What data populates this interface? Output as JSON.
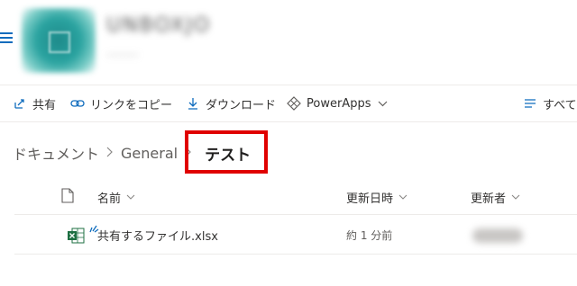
{
  "site": {
    "name": "UNBOXJO",
    "subtitle": "········"
  },
  "commands": {
    "share": "共有",
    "copy_link": "リンクをコピー",
    "download": "ダウンロード",
    "powerapps": "PowerApps",
    "all": "すべて"
  },
  "breadcrumb": {
    "items": [
      "ドキュメント",
      "General"
    ],
    "current": "テスト"
  },
  "list": {
    "columns": {
      "name": "名前",
      "modified": "更新日時",
      "modified_by": "更新者"
    },
    "rows": [
      {
        "name": "共有するファイル.xlsx",
        "modified": "約 1 分前",
        "modified_by": ""
      }
    ]
  },
  "colors": {
    "accent": "#0f6cbd",
    "highlight": "#e00000",
    "excel": "#1d6f42"
  },
  "icons": [
    "hamburger-icon",
    "share-icon",
    "link-icon",
    "download-icon",
    "powerapps-icon",
    "list-view-icon",
    "file-type-icon",
    "excel-icon"
  ]
}
